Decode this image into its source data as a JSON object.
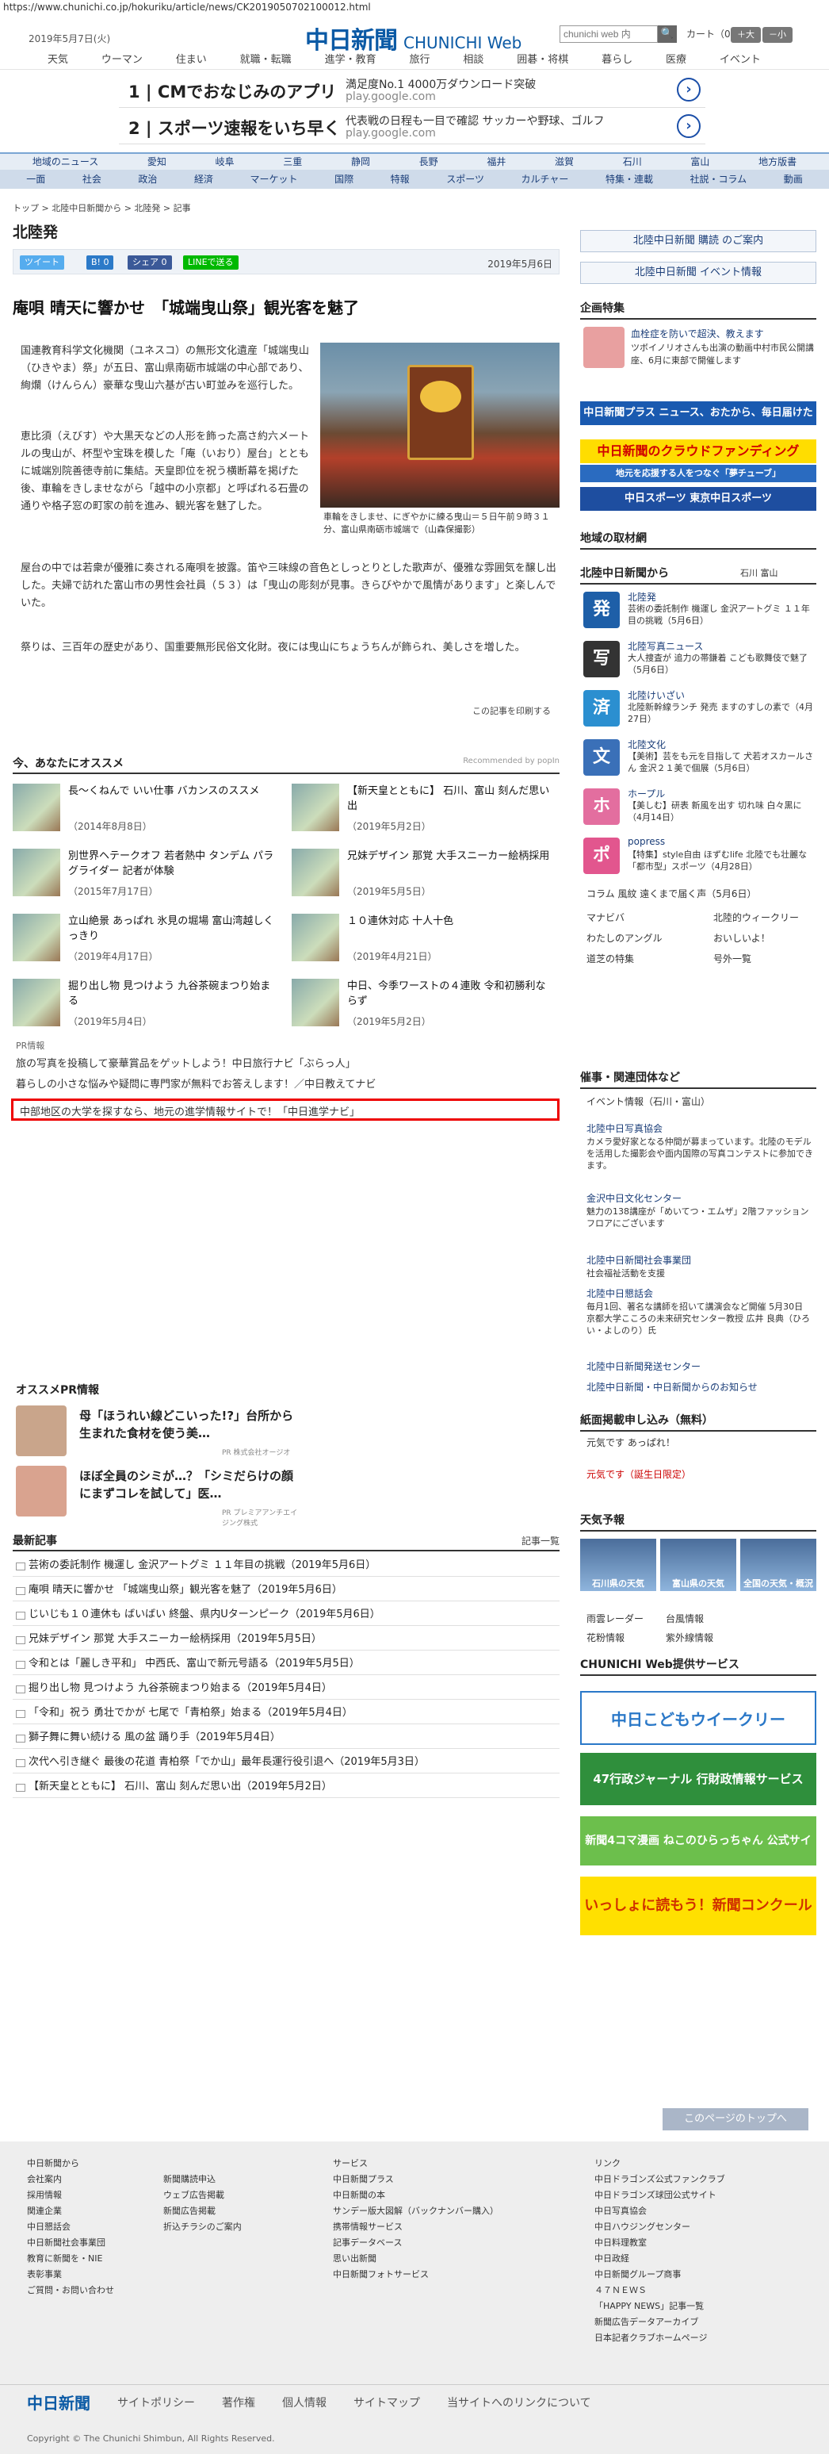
{
  "url": "https://www.chunichi.co.jp/hokuriku/article/news/CK2019050702100012.html",
  "header": {
    "date": "2019年5月7日(火)",
    "logo": "中日新聞",
    "logo_web": "CHUNICHI Web",
    "search_placeholder": "chunichi web 内",
    "search_icon": "🔍",
    "cart": "カート（0）",
    "font_large": "＋大",
    "font_small": "－小"
  },
  "topnav": [
    "天気",
    "ウーマン",
    "住まい",
    "就職・転職",
    "進学・教育",
    "旅行",
    "相談",
    "囲碁・将棋",
    "暮らし",
    "医療",
    "イベント"
  ],
  "ads": [
    {
      "title": "1 | CMでおなじみのアプリ",
      "desc": "満足度No.1 4000万ダウンロード突破",
      "src": "play.google.com"
    },
    {
      "title": "2 | スポーツ速報をいち早く",
      "desc": "代表戦の日程も一目で確認 サッカーや野球、ゴルフ",
      "src": "play.google.com"
    }
  ],
  "nav1": [
    "地域のニュース",
    "愛知",
    "岐阜",
    "三重",
    "静岡",
    "長野",
    "福井",
    "滋賀",
    "石川",
    "富山",
    "地方版書"
  ],
  "nav2": [
    "一面",
    "社会",
    "政治",
    "経済",
    "マーケット",
    "国際",
    "特報",
    "スポーツ",
    "カルチャー",
    "特集・連載",
    "社説・コラム",
    "動画"
  ],
  "breadcrumb": "トップ > 北陸中日新聞から > 北陸発 > 記事",
  "section": "北陸発",
  "share": {
    "tweet": "ツイート",
    "b": "B! 0",
    "fb": "シェア 0",
    "line": "LINEで送る"
  },
  "article": {
    "date": "2019年5月6日",
    "headline": "庵唄 晴天に響かせ　「城端曳山祭」観光客を魅了",
    "paras": [
      "国連教育科学文化機関（ユネスコ）の無形文化遺産「城端曳山（ひきやま）祭」が五日、富山県南砺市城端の中心部であり、絢爛（けんらん）豪華な曳山六基が古い町並みを巡行した。",
      "恵比須（えびす）や大黒天などの人形を飾った高さ約六メートルの曳山が、杯型や宝珠を模した「庵（いおり）屋台」とともに城端別院善徳寺前に集結。天皇即位を祝う横断幕を掲げた後、車輪をきしませながら「越中の小京都」と呼ばれる石畳の通りや格子窓の町家の前を進み、観光客を魅了した。",
      "屋台の中では若衆が優雅に奏される庵唄を披露。笛や三味線の音色としっとりとした歌声が、優雅な雰囲気を醸し出した。夫婦で訪れた富山市の男性会社員（５３）は「曳山の彫刻が見事。きらびやかで風情があります」と楽しんでいた。",
      "祭りは、三百年の歴史があり、国重要無形民俗文化財。夜には曳山にちょうちんが飾られ、美しさを増した。"
    ],
    "caption": "車輪をきしませ、にぎやかに練る曳山＝５日午前９時３１分、富山県南砺市城端で（山森保撮影）",
    "print": "この記事を印刷する"
  },
  "recommend": {
    "title": "今、あなたにオススメ",
    "powered": "Recommended by popIn",
    "items": [
      {
        "t": "長～くねんで いい仕事 バカンスのススメ",
        "d": "（2014年8月8日）"
      },
      {
        "t": "【新天皇とともに】 石川、富山 刻んだ思い出",
        "d": "（2019年5月2日）"
      },
      {
        "t": "別世界ヘテークオフ 若者熱中 タンデム パラグライダー 記者が体験",
        "d": "（2015年7月17日）"
      },
      {
        "t": "兄妹デザイン 那覚 大手スニーカー絵柄採用",
        "d": "（2019年5月5日）"
      },
      {
        "t": "立山絶景 あっぱれ 氷見の堀場 富山湾越しくっきり",
        "d": "（2019年4月17日）"
      },
      {
        "t": "１０連休対応 十人十色",
        "d": "（2019年4月21日）"
      },
      {
        "t": "掘り出し物 見つけよう 九谷茶碗まつり始まる",
        "d": "（2019年5月4日）"
      },
      {
        "t": "中日、今季ワーストの４連敗 令和初勝利ならず",
        "d": "（2019年5月2日）"
      }
    ]
  },
  "pr_label": "PR情報",
  "pr": [
    "旅の写真を投稿して豪華賞品をゲットしよう！中日旅行ナビ「ぶらっ人」",
    "暮らしの小さな悩みや疑問に専門家が無料でお答えします！／中日教えてナビ",
    "中部地区の大学を探すなら、地元の進学情報サイトで！「中日進学ナビ」"
  ],
  "pr2": {
    "title": "オススメPR情報",
    "items": [
      {
        "t": "母「ほうれい線どこいった!?」台所から生まれた食材を使う美…",
        "s": "PR 株式会社オージオ"
      },
      {
        "t": "ほぼ全員のシミが…？「シミだらけの顔にまずコレを試して」医…",
        "s": "PR プレミアアンチエイジング株式"
      }
    ]
  },
  "latest": {
    "title": "最新記事",
    "list_link": "記事一覧",
    "items": [
      "芸術の委託制作 機運し 金沢アートグミ １１年目の挑戦（2019年5月6日）",
      "庵唄 晴天に響かせ 「城端曳山祭」観光客を魅了（2019年5月6日）",
      "じいじも１０連休も ばいばい 終盤、県内Uターンピーク（2019年5月6日）",
      "兄妹デザイン 那覚 大手スニーカー絵柄採用（2019年5月5日）",
      "令和とは「麗しき平和」 中西氏、富山で新元号語る（2019年5月5日）",
      "掘り出し物 見つけよう 九谷茶碗まつり始まる（2019年5月4日）",
      "「令和」祝う 勇壮でかが 七尾で「青柏祭」始まる（2019年5月4日）",
      "獅子舞に舞い続ける 風の盆 踊り手（2019年5月4日）",
      "次代へ引き継ぐ 最後の花道 青柏祭「でか山」最年長運行役引退へ（2019年5月3日）",
      "【新天皇とともに】 石川、富山 刻んだ思い出（2019年5月2日）"
    ]
  },
  "right": {
    "subscribe": "北陸中日新聞 購読 のご案内",
    "event": "北陸中日新聞 イベント情報",
    "kikaku": "企画特集",
    "kikaku_title": "血栓症を防いで超決、教えます",
    "kikaku_text": "ツボイノリオさんも出演の動画中村市民公開講座、6月に東部で開催します",
    "banners": [
      "中日新聞プラス ニュース、おたから、毎日届けたくさん",
      "中日新聞のクラウドファンディング",
      "地元を応援する人をつなぐ「夢チューブ」",
      "中日スポーツ 東京中日スポーツ"
    ],
    "torikumi": "地域の取材網",
    "hokuriku": "北陸中日新聞から",
    "hokuriku_sub": "石川  富山",
    "cats": [
      {
        "ic": "発",
        "n": "北陸発",
        "x": "芸術の委託制作 機運し 金沢アートグミ １１年目の挑戦（5月6日）",
        "c": "#1e5fa8"
      },
      {
        "ic": "写",
        "n": "北陸写真ニュース",
        "x": "大人捜査が 追力の帯鎌着 こども歌舞伎で魅了（5月6日）",
        "c": "#333"
      },
      {
        "ic": "済",
        "n": "北陸けいざい",
        "x": "北陸新幹線ランチ 発売 ますのすしの素で（4月27日）",
        "c": "#2b8fd0"
      },
      {
        "ic": "文",
        "n": "北陸文化",
        "x": "【美術】芸をも元を目指して 犬若オスカールさん 金沢２１美で個展（5月6日）",
        "c": "#3a70b8"
      },
      {
        "ic": "ホ",
        "n": "ホープル",
        "x": "【美しむ】研表 新風を出す 切れ味 白々黒に（4月14日）",
        "c": "#e36e9f"
      },
      {
        "ic": "ポ",
        "n": "popress",
        "x": "【特集】style自由 ほずむlife 北陸でも壮麗な「都市型」スポーツ（4月28日）",
        "c": "#e2568e"
      }
    ],
    "links": [
      "コラム 風紋 遠くまで届く声（5月6日）",
      "マナビバ",
      "北陸的ウィークリー",
      "わたしのアングル",
      "おいしいよ！",
      "道芝の特集",
      "号外一覧"
    ],
    "saiji": "催事・関連団体など",
    "event_info": "イベント情報（石川・富山）",
    "orgs": [
      {
        "n": "北陸中日写真協会",
        "x": "カメラ愛好家となる仲間が募まっています。北陸のモデルを活用した撮影会や面内国際の写真コンテストに参加できます。"
      },
      {
        "n": "金沢中日文化センター",
        "x": "魅力の138講座が「めいてつ・エムザ」2階ファッションフロアにございます"
      },
      {
        "n": "北陸中日新聞社会事業団",
        "x": "社会福祉活動を支援"
      },
      {
        "n": "北陸中日懇話会",
        "x": "毎月1回、著名な講師を招いて講演会など開催 5月30日 京都大学こころの未来研究センター教授 広井 良典（ひろい・よしのり）氏"
      }
    ],
    "kansai": "北陸中日新聞発送センター",
    "sunday": "北陸中日新聞・中日新聞からのお知らせ",
    "moshikomi": "紙面掲載申し込み（無料）",
    "moshi_links": [
      "元気です あっぱれ！",
      "元気です（誕生日限定）"
    ],
    "tenki": "天気予報",
    "tiles": [
      "石川県の天気",
      "富山県の天気",
      "全国の天気・概況"
    ],
    "tenki_links": [
      "雨雲レーダー",
      "台風情報",
      "花粉情報",
      "紫外線情報"
    ],
    "service": "CHUNICHI Web提供サービス",
    "svc_banners": [
      "中日こどもウイークリー",
      "47行政ジャーナル 行財政情報サービス",
      "新聞4コマ漫画 ねこのひらっちゃん 公式サイト",
      "いっしょに読もう！新聞コンクール"
    ]
  },
  "footer": {
    "totop": "このページのトップへ",
    "col1": [
      "中日新聞から",
      "会社案内",
      "採用情報",
      "関連企業",
      "中日懇話会",
      "中日新聞社会事業団",
      "教育に新聞を・NIE",
      "表彰事業",
      "ご質問・お問い合わせ"
    ],
    "col2": [
      "新聞購読申込",
      "ウェブ広告掲載",
      "新聞広告掲載",
      "折込チラシのご案内"
    ],
    "col3": [
      "サービス",
      "中日新聞プラス",
      "中日新聞の本",
      "サンデー版大図解（バックナンバー購入）",
      "携帯情報サービス",
      "記事データベース",
      "思い出新聞",
      "中日新聞フォトサービス"
    ],
    "col4": [
      "リンク",
      "中日ドラゴンズ公式ファンクラブ",
      "中日ドラゴンズ球団公式サイト",
      "中日写真協会",
      "中日ハウジングセンター",
      "中日料理教室",
      "中日政経",
      "中日新聞グループ商事",
      "４７ＮＥＷＳ",
      "「HAPPY NEWS」記事一覧",
      "新聞広告データアーカイブ",
      "日本記者クラブホームページ"
    ],
    "nav": [
      "中日新聞",
      "サイトポリシー",
      "著作権",
      "個人情報",
      "サイトマップ",
      "当サイトへのリンクについて"
    ],
    "copy": "Copyright © The Chunichi Shimbun, All Rights Reserved."
  }
}
